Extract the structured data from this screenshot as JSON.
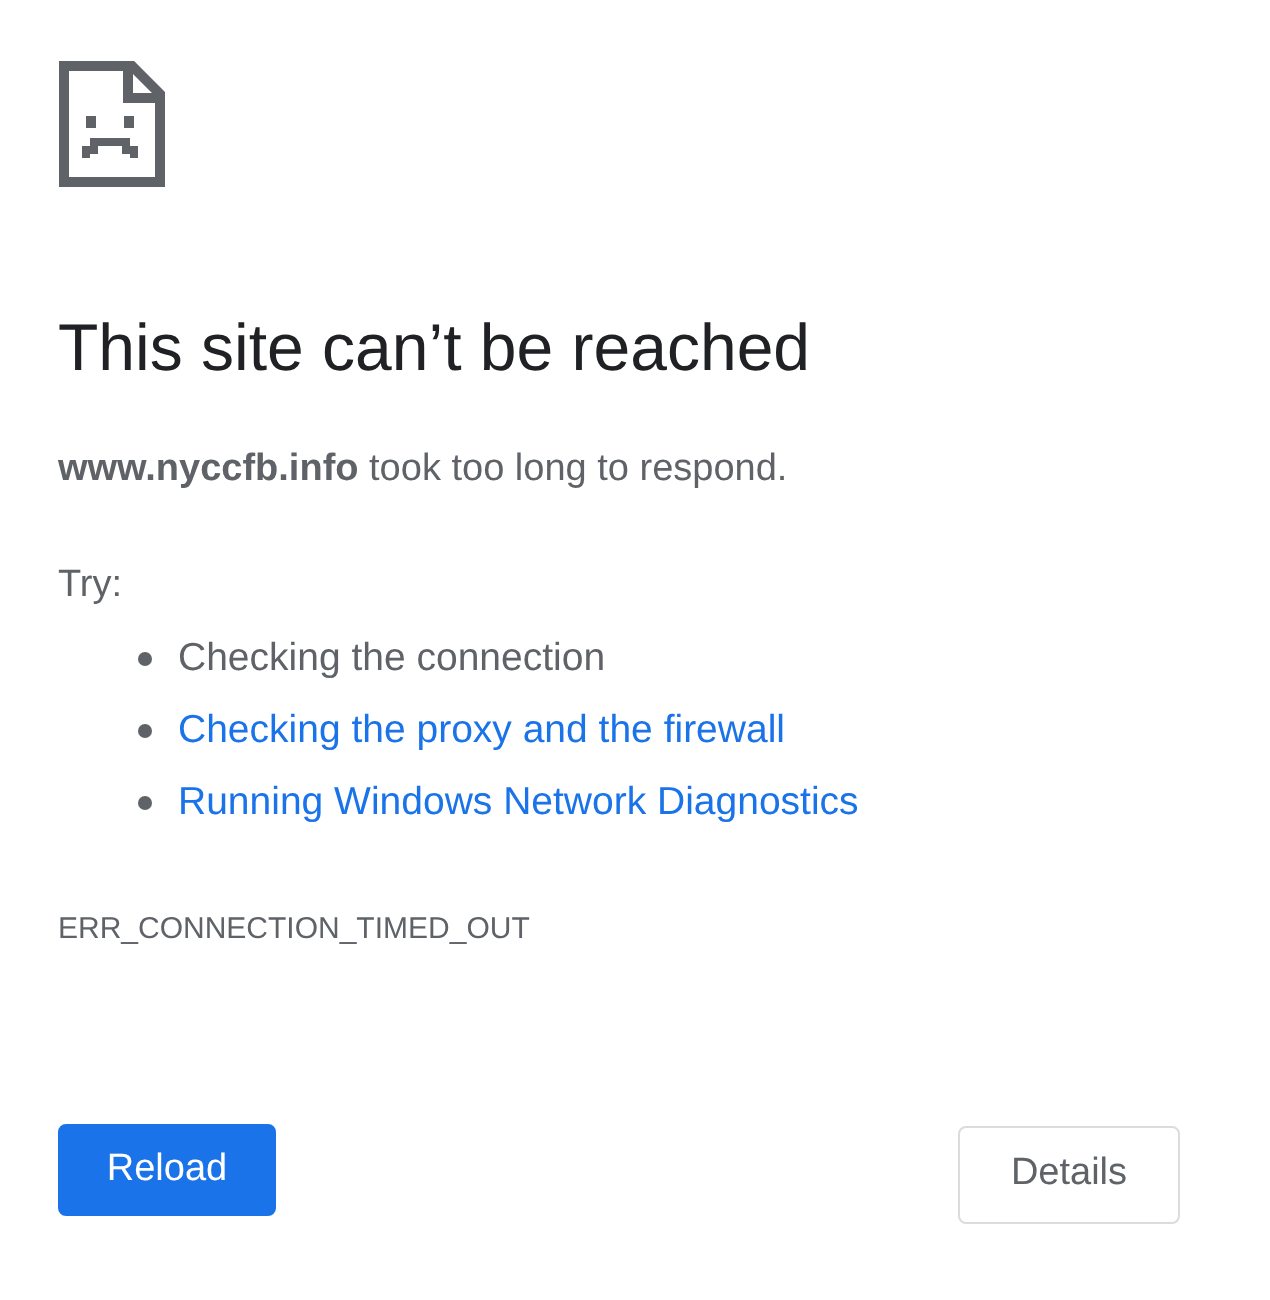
{
  "title": "This site can’t be reached",
  "message": "**www.nyccfb.info** took too long to respond.",
  "try_label": "Try:",
  "suggestions": [
    {
      "kind": "text",
      "label": "Checking the connection"
    },
    {
      "kind": "link",
      "label": "Checking the proxy and the firewall"
    },
    {
      "kind": "link",
      "label": "Running Windows Network Diagnostics"
    }
  ],
  "error_code": "ERR_CONNECTION_TIMED_OUT",
  "buttons": [
    {
      "kind": "primary",
      "label": "Reload"
    },
    {
      "kind": "secondary",
      "label": "Details"
    }
  ]
}
